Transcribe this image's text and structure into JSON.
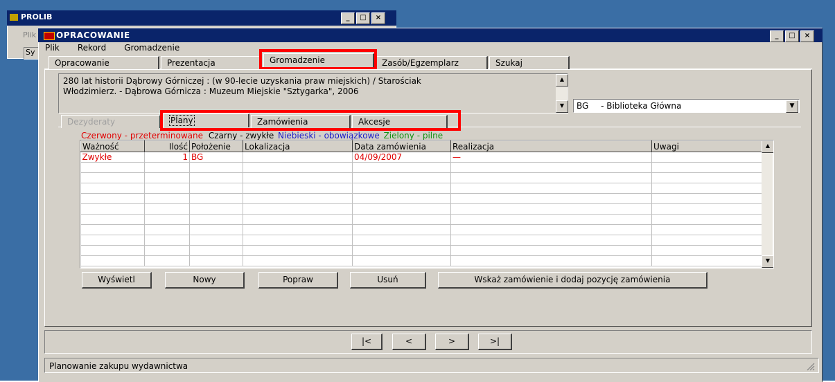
{
  "bg_window": {
    "title": "PROLIB",
    "menu_fragment": "Plik",
    "field_fragment": "Sy"
  },
  "window": {
    "title": "OPRACOWANIE"
  },
  "menu": [
    "Plik",
    "Rekord",
    "Gromadzenie"
  ],
  "main_tabs": [
    "Opracowanie",
    "Prezentacja",
    "Gromadzenie",
    "Zasób/Egzemplarz",
    "Szukaj"
  ],
  "description": {
    "line1": "280 lat historii Dąbrowy Górniczej : (w 90-lecie uzyskania praw miejskich) / Starościak",
    "line2": "Włodzimierz. - Dąbrowa Górnicza : Muzeum Miejskie \"Sztygarka\", 2006"
  },
  "library_select": {
    "code": "BG",
    "name": "- Biblioteka Główna"
  },
  "sub_tabs": {
    "dezyderaty": "Dezyderaty",
    "plany": "Plany",
    "zamowienia": "Zamówienia",
    "akcesje": "Akcesje"
  },
  "legend": {
    "red": "Czerwony - przeterminowane",
    "black": "Czarny - zwykłe",
    "blue": "Niebieski - obowiązkowe",
    "green": "Zielony - pilne"
  },
  "colors": {
    "red": "#e00000",
    "black": "#000000",
    "blue": "#1a1ac8",
    "green": "#109010"
  },
  "table": {
    "columns": [
      "Ważność",
      "Ilość",
      "Położenie",
      "Lokalizacja",
      "Data zamówienia",
      "Realizacja",
      "Uwagi"
    ],
    "rows": [
      [
        "Zwykłe",
        "1",
        "BG",
        "",
        "04/09/2007",
        "—",
        ""
      ]
    ]
  },
  "buttons": {
    "wyswietl": "Wyświetl",
    "nowy": "Nowy",
    "popraw": "Popraw",
    "usun": "Usuń",
    "wskaz": "Wskaż zamówienie i dodaj pozycję zamówienia"
  },
  "nav": {
    "first": "|<",
    "prev": "<",
    "next": ">",
    "last": ">|"
  },
  "status": "Planowanie zakupu wydawnictwa",
  "window_buttons": {
    "minimize": "_",
    "maximize": "□",
    "close": "×"
  }
}
